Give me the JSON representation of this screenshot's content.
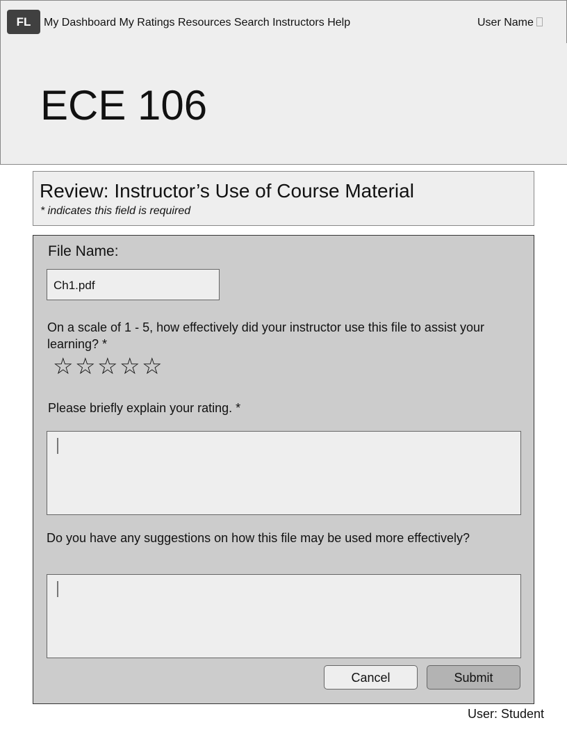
{
  "nav": {
    "logo": "FL",
    "links": [
      "My Dashboard",
      "My Ratings",
      "Resources",
      "Search Instructors",
      "Help"
    ],
    "user_menu": "User Name"
  },
  "course": {
    "title": "ECE 106"
  },
  "review": {
    "title": "Review: Instructor’s Use of Course Material",
    "required_note": "* indicates this field is required"
  },
  "form": {
    "file_label": "File Name:",
    "file_value": "Ch1.pdf",
    "rating_question": "On a scale of 1 - 5, how effectively did your instructor use this file to assist your learning? *",
    "rating": {
      "value": 0,
      "max": 5,
      "star_glyph": "☆"
    },
    "explain_label": "Please briefly explain your rating. *",
    "explain_value": "",
    "suggest_label": "Do you have any suggestions on how this file may be used more effectively?",
    "suggest_value": "",
    "cancel_label": "Cancel",
    "submit_label": "Submit"
  },
  "footer": {
    "user_text": "User: Student"
  }
}
